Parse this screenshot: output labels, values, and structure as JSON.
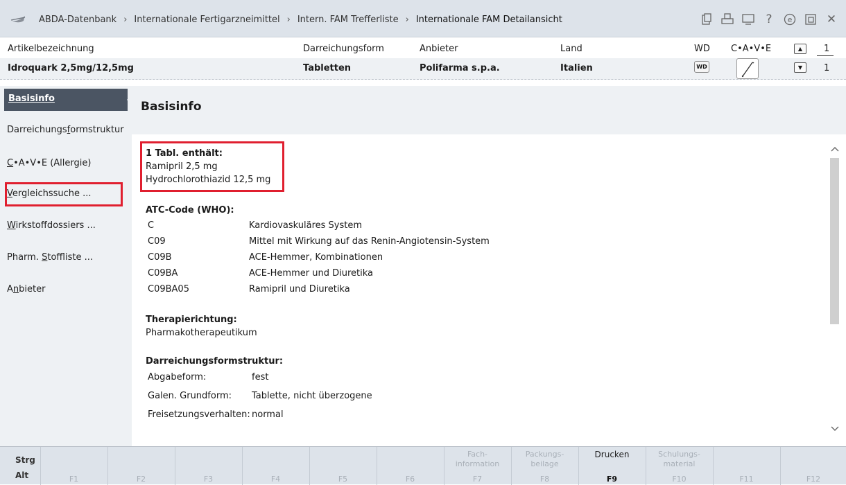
{
  "breadcrumb": {
    "items": [
      "ABDA-Datenbank",
      "Internationale Fertigarzneimittel",
      "Intern. FAM Trefferliste",
      "Internationale FAM Detailansicht"
    ],
    "separator": "›"
  },
  "toolbar_icons": [
    "clipboard-icon",
    "printer-icon",
    "monitor-icon",
    "help-icon",
    "e-icon",
    "window-icon",
    "close-icon"
  ],
  "article": {
    "labels": {
      "name": "Artikelbezeichnung",
      "form": "Darreichungsform",
      "provider": "Anbieter",
      "country": "Land",
      "wd": "WD",
      "cave": "C•A•V•E"
    },
    "values": {
      "name": "Idroquark 2,5mg/12,5mg",
      "form": "Tabletten",
      "provider": "Polifarma s.p.a.",
      "country": "Italien",
      "wd_badge": "WD"
    },
    "counter_top": "1",
    "counter_bottom": "1"
  },
  "sidebar": {
    "items": [
      {
        "label": "Basisinfo",
        "active": true
      },
      {
        "label_pre": "Darreichungs",
        "label_u": "f",
        "label_post": "ormstruktur"
      },
      {
        "label_pre": "",
        "label_u": "C",
        "label_post": "•A•V•E (Allergie)"
      },
      {
        "label_pre": "",
        "label_u": "V",
        "label_post": "ergleichssuche ..."
      },
      {
        "label_pre": "",
        "label_u": "W",
        "label_post": "irkstoffdossiers ..."
      },
      {
        "label_pre": "Pharm. ",
        "label_u": "S",
        "label_post": "toffliste ..."
      },
      {
        "label_pre": "A",
        "label_u": "n",
        "label_post": "bieter"
      }
    ]
  },
  "content": {
    "title": "Basisinfo",
    "composition_heading": "1 Tabl. enthält:",
    "composition": [
      "Ramipril 2,5 mg",
      "Hydrochlorothiazid 12,5 mg"
    ],
    "atc_heading": "ATC-Code (WHO):",
    "atc_rows": [
      {
        "code": "C",
        "desc": "Kardiovaskuläres System"
      },
      {
        "code": "C09",
        "desc": "Mittel mit Wirkung auf das Renin-Angiotensin-System"
      },
      {
        "code": "C09B",
        "desc": "ACE-Hemmer, Kombinationen"
      },
      {
        "code": "C09BA",
        "desc": "ACE-Hemmer und Diuretika"
      },
      {
        "code": "C09BA05",
        "desc": "Ramipril und Diuretika"
      }
    ],
    "therapy_heading": "Therapierichtung:",
    "therapy_value": "Pharmakotherapeutikum",
    "form_heading": "Darreichungsformstruktur:",
    "form_rows": [
      {
        "label": "Abgabeform:",
        "value": "fest"
      },
      {
        "label": "Galen. Grundform:",
        "value": "Tablette, nicht überzogene"
      },
      {
        "label": "Freisetzungsverhalten:",
        "value": "normal"
      }
    ]
  },
  "fkeys": {
    "mod_top": "Strg",
    "mod_bottom": "Alt",
    "keys": [
      {
        "num": "F1",
        "label": ""
      },
      {
        "num": "F2",
        "label": ""
      },
      {
        "num": "F3",
        "label": ""
      },
      {
        "num": "F4",
        "label": ""
      },
      {
        "num": "F5",
        "label": ""
      },
      {
        "num": "F6",
        "label": ""
      },
      {
        "num": "F7",
        "label": "Fach-\ninformation"
      },
      {
        "num": "F8",
        "label": "Packungs-\nbeilage"
      },
      {
        "num": "F9",
        "label": "Drucken",
        "active": true
      },
      {
        "num": "F10",
        "label": "Schulungs-\nmaterial"
      },
      {
        "num": "F11",
        "label": ""
      },
      {
        "num": "F12",
        "label": ""
      }
    ]
  }
}
